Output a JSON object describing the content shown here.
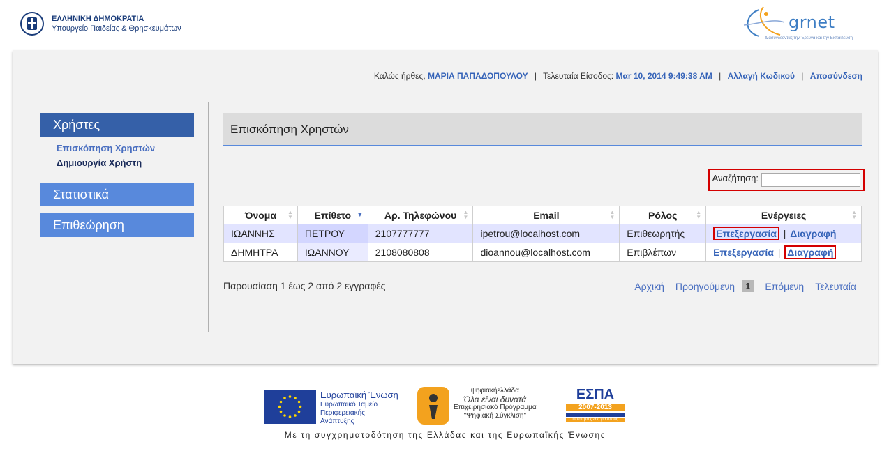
{
  "header": {
    "ministry_line1": "ΕΛΛΗΝΙΚΗ ΔΗΜΟΚΡΑΤΙΑ",
    "ministry_line2": "Υπουργείο Παιδείας & Θρησκευμάτων",
    "grnet_word": "grnet",
    "grnet_tagline": "Διασυνδέοντας την Έρευνα και την Εκπαίδευση"
  },
  "userbar": {
    "welcome": "Καλώς ήρθες,",
    "user_name": "ΜΑΡΙΑ ΠΑΠΑΔΟΠΟΥΛΟΥ",
    "last_login_label": "Τελευταία Είσοδος:",
    "last_login_value": "Μαr 10, 2014 9:49:38 AM",
    "change_password": "Αλλαγή Κωδικού",
    "logout": "Αποσύνδεση"
  },
  "sidebar": {
    "users": "Χρήστες",
    "users_overview": "Επισκόπηση Χρηστών",
    "users_create": "Δημιουργία Χρήστη",
    "statistics": "Στατιστικά",
    "inspection": "Επιθεώρηση"
  },
  "content": {
    "title": "Επισκόπηση Χρηστών",
    "search_label": "Αναζήτηση:",
    "search_value": ""
  },
  "table": {
    "headers": [
      "Όνομα",
      "Επίθετο",
      "Αρ. Τηλεφώνου",
      "Email",
      "Ρόλος",
      "Ενέργειες"
    ],
    "rows": [
      {
        "first": "ΙΩΑΝΝΗΣ",
        "last": "ΠΕΤΡΟΥ",
        "phone": "2107777777",
        "email": "ipetrou@localhost.com",
        "role": "Επιθεωρητής",
        "edit": "Επεξεργασία",
        "sep": "|",
        "delete": "Διαγραφή"
      },
      {
        "first": "ΔΗΜΗΤΡΑ",
        "last": "ΙΩΑΝΝΟΥ",
        "phone": "2108080808",
        "email": "dioannou@localhost.com",
        "role": "Επιβλέπων",
        "edit": "Επεξεργασία",
        "sep": "|",
        "delete": "Διαγραφή"
      }
    ]
  },
  "footer_info": "Παρουσίαση 1 έως 2 από 2 εγγραφές",
  "pager": {
    "first": "Αρχική",
    "prev": "Προηγούμενη",
    "current": "1",
    "next": "Επόμενη",
    "last": "Τελευταία"
  },
  "funding": {
    "eu_title": "Ευρωπαϊκή Ένωση",
    "eu_fund1": "Ευρωπαϊκό Ταμείο",
    "eu_fund2": "Περιφερειακής",
    "eu_fund3": "Ανάπτυξης",
    "psif_title": "ψηφιακήελλάδα",
    "psif_slogan": "Όλα είναι δυνατά",
    "psif_prog1": "Επιχειρησιακό Πρόγραμμα",
    "psif_prog2": "\"Ψηφιακή Σύγκλιση\"",
    "espa_word": "ΕΣΠΑ",
    "espa_years": "2007-2013",
    "espa_slogan": "Ποιότητα ζωής για όλους",
    "caption": "Με τη συγχρηματοδότηση της Ελλάδας και της Ευρωπαϊκής Ένωσης"
  }
}
